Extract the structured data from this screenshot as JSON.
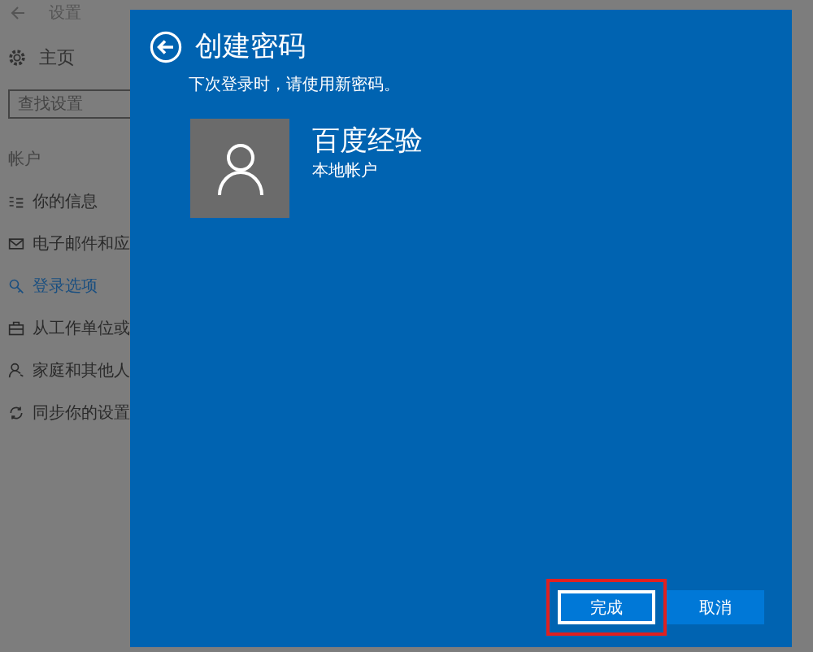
{
  "window": {
    "title": "设置"
  },
  "sidebar": {
    "home": "主页",
    "search": {
      "placeholder": "查找设置"
    },
    "section": "帐户",
    "items": [
      {
        "label": "你的信息",
        "selected": false
      },
      {
        "label": "电子邮件和应",
        "selected": false
      },
      {
        "label": "登录选项",
        "selected": true
      },
      {
        "label": "从工作单位或",
        "selected": false
      },
      {
        "label": "家庭和其他人",
        "selected": false
      },
      {
        "label": "同步你的设置",
        "selected": false
      }
    ]
  },
  "dialog": {
    "title": "创建密码",
    "subtitle": "下次登录时，请使用新密码。",
    "account": {
      "name": "百度经验",
      "type": "本地帐户"
    },
    "buttons": [
      {
        "label": "完成",
        "focused": true,
        "highlighted": true
      },
      {
        "label": "取消",
        "focused": false,
        "highlighted": false
      }
    ]
  }
}
